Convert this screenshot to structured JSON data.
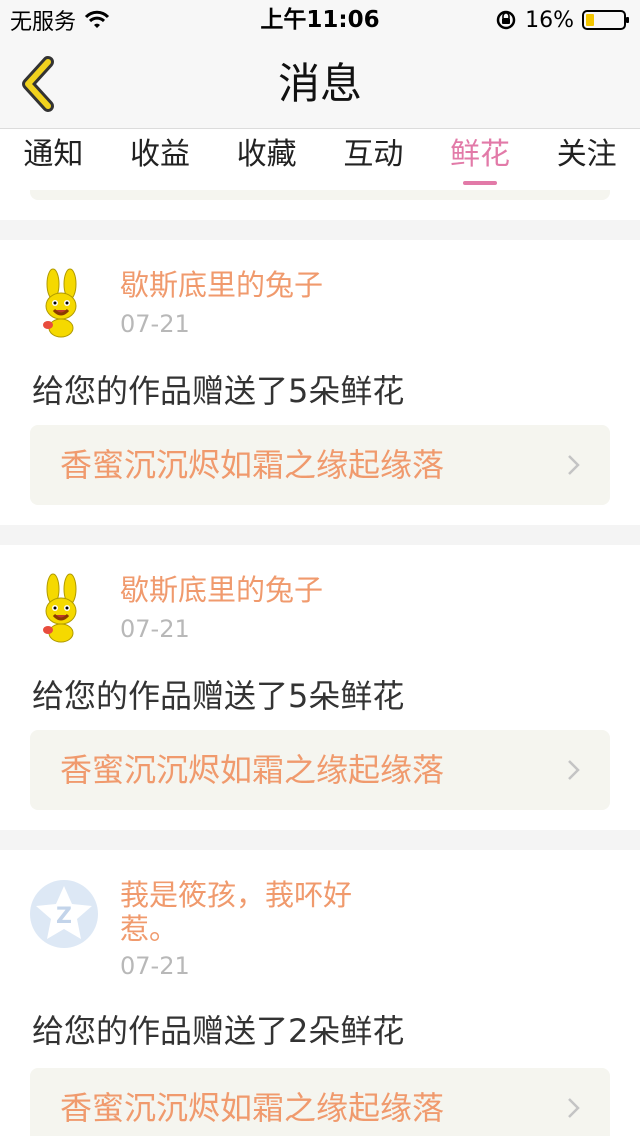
{
  "status_bar": {
    "carrier": "无服务",
    "time": "上午11:06",
    "battery": "16%",
    "icons": [
      "wifi-icon",
      "rotation-lock-icon",
      "battery-icon"
    ]
  },
  "nav": {
    "title": "消息",
    "back_icon": "chevron-left-icon"
  },
  "tabs": [
    {
      "label": "通知",
      "active": false
    },
    {
      "label": "收益",
      "active": false
    },
    {
      "label": "收藏",
      "active": false
    },
    {
      "label": "互动",
      "active": false
    },
    {
      "label": "鲜花",
      "active": true
    },
    {
      "label": "关注",
      "active": false
    }
  ],
  "messages": [
    {
      "username": "歇斯底里的兔子",
      "date": "07-21",
      "text": "给您的作品赠送了5朵鲜花",
      "work_title": "香蜜沉沉烬如霜之缘起缘落",
      "avatar_icon": "rabbit-avatar-icon"
    },
    {
      "username": "歇斯底里的兔子",
      "date": "07-21",
      "text": "给您的作品赠送了5朵鲜花",
      "work_title": "香蜜沉沉烬如霜之缘起缘落",
      "avatar_icon": "rabbit-avatar-icon"
    },
    {
      "username": "莪是筱孩，莪吥好惹。",
      "date": "07-21",
      "text": "给您的作品赠送了2朵鲜花",
      "work_title": "香蜜沉沉烬如霜之缘起缘落",
      "avatar_icon": "qq-default-avatar-icon"
    }
  ],
  "colors": {
    "accent_pink": "#e27aa8",
    "username_orange": "#f09a6d",
    "link_bg": "#f5f5ef",
    "back_icon_yellow": "#f1d21e"
  }
}
